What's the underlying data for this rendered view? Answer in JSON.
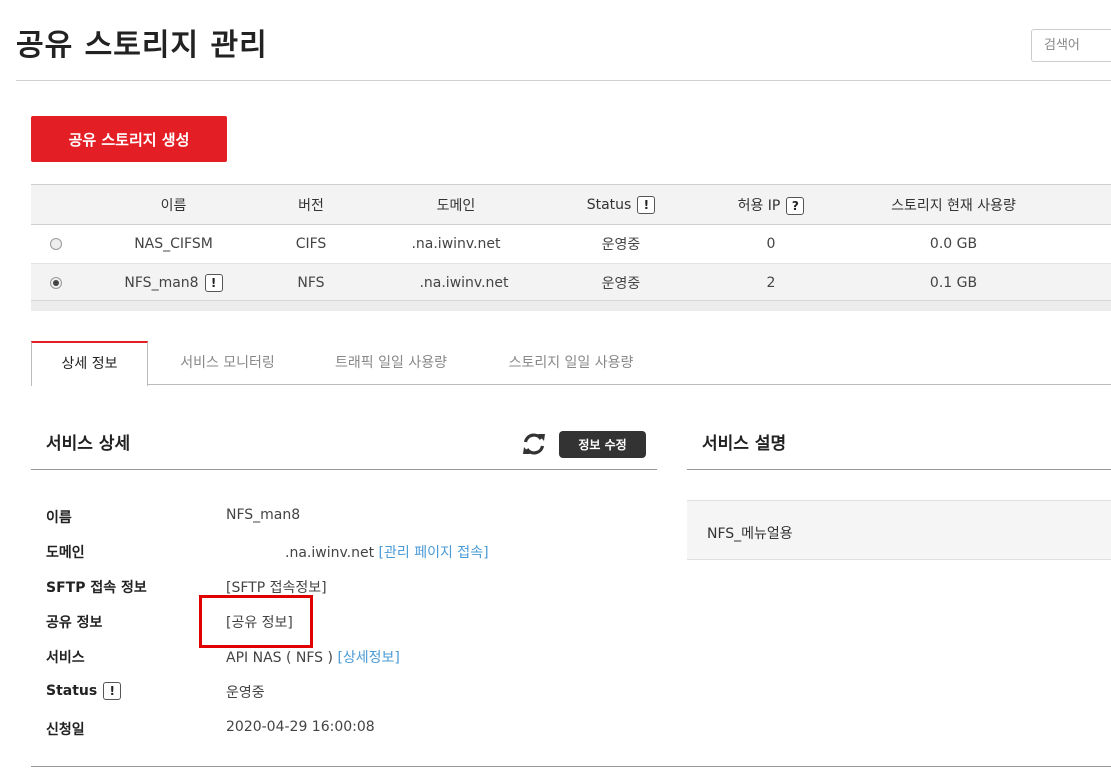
{
  "header": {
    "title": "공유 스토리지 관리",
    "search_placeholder": "검색어"
  },
  "create_button": "공유 스토리지 생성",
  "table": {
    "columns": [
      "이름",
      "버전",
      "도메인",
      "Status",
      "허용 IP",
      "스토리지 현재 사용량"
    ],
    "status_tag": "!",
    "ip_tag": "?",
    "rows": [
      {
        "selected": false,
        "name": "NAS_CIFSM",
        "name_tag": "",
        "version": "CIFS",
        "domain": ".na.iwinv.net",
        "status": "운영중",
        "allowed_ip": "0",
        "usage": "0.0 GB"
      },
      {
        "selected": true,
        "name": "NFS_man8",
        "name_tag": "!",
        "version": "NFS",
        "domain": ".na.iwinv.net",
        "status": "운영중",
        "allowed_ip": "2",
        "usage": "0.1 GB"
      }
    ]
  },
  "tabs": [
    "상세 정보",
    "서비스 모니터링",
    "트래픽 일일 사용량",
    "스토리지 일일 사용량"
  ],
  "service_detail": {
    "title": "서비스 상세",
    "edit_button": "정보 수정",
    "labels": {
      "name": "이름",
      "domain": "도메인",
      "sftp": "SFTP 접속 정보",
      "share": "공유 정보",
      "service": "서비스",
      "status": "Status",
      "status_tag": "!",
      "applied": "신청일"
    },
    "values": {
      "name": "NFS_man8",
      "domain": ".na.iwinv.net",
      "domain_link": "[관리 페이지 접속]",
      "sftp_link": "[SFTP 접속정보]",
      "share_link": "[공유 정보]",
      "service": "API NAS ( NFS )",
      "service_link": "[상세정보]",
      "status": "운영중",
      "applied": "2020-04-29 16:00:08"
    }
  },
  "service_description": {
    "title": "서비스 설명",
    "text": "NFS_메뉴얼용"
  },
  "colors": {
    "accent": "#e31e24",
    "link": "#4a9bd6",
    "highlight": "#e00000"
  }
}
